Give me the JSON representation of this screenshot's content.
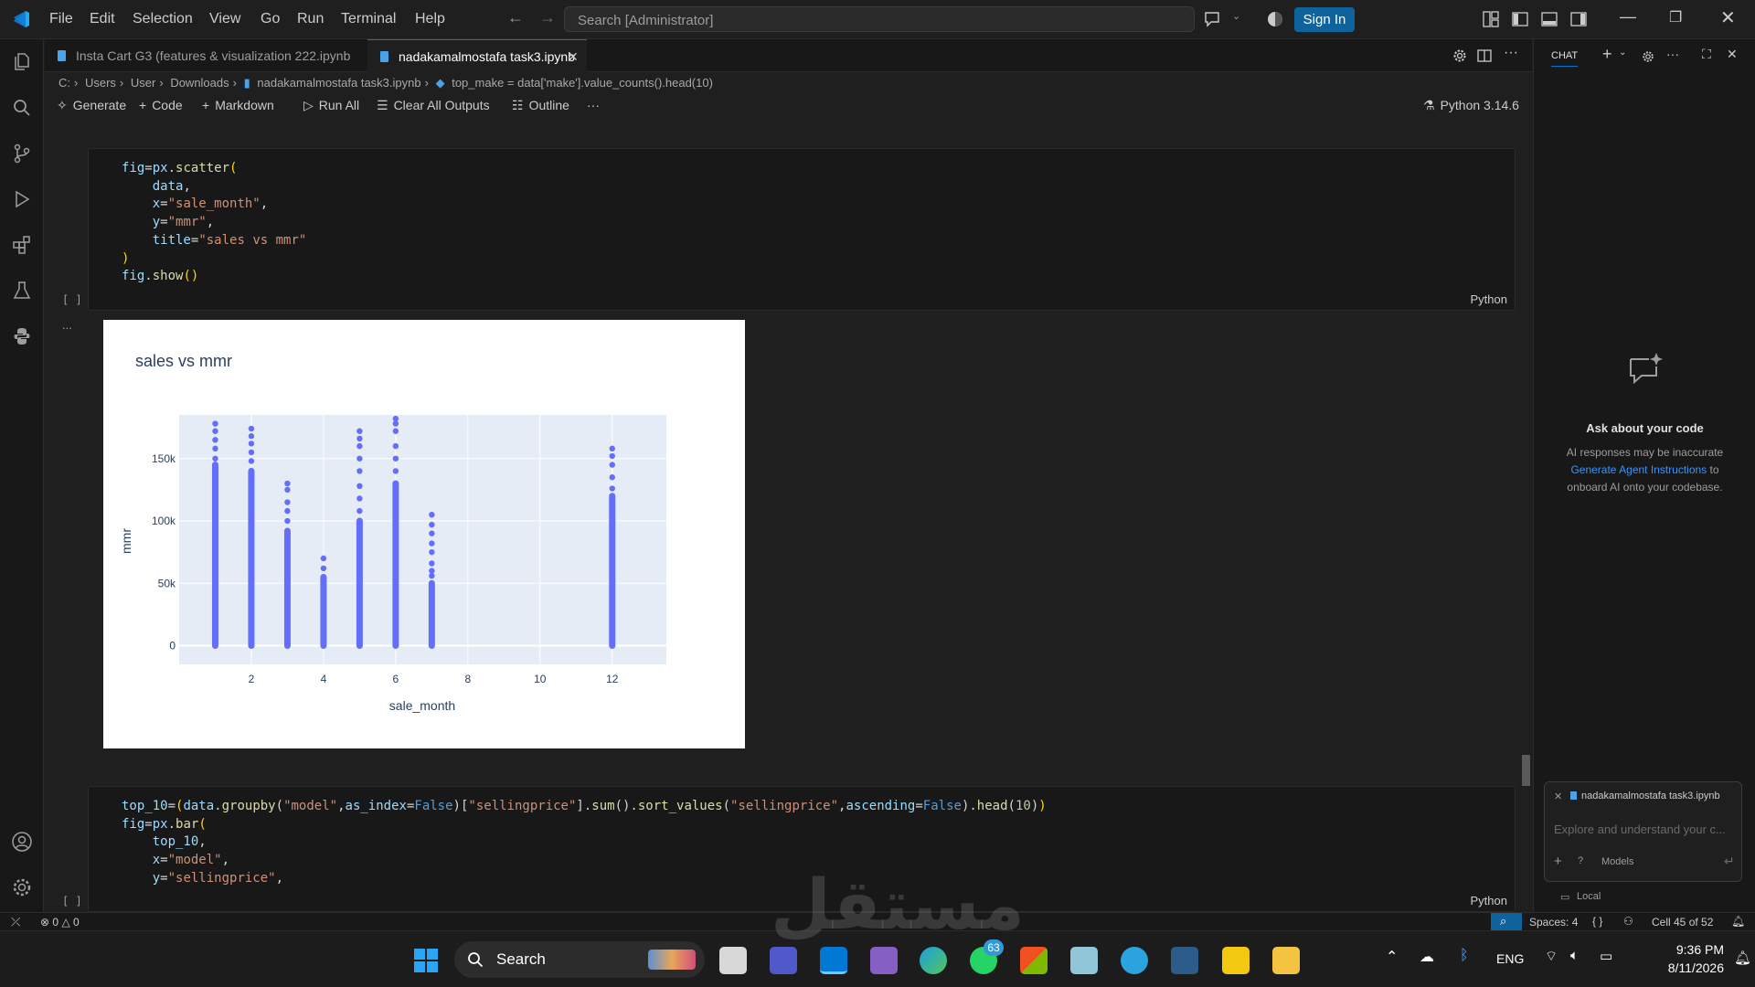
{
  "titlebar": {
    "menu": [
      "File",
      "Edit",
      "Selection",
      "View",
      "Go",
      "Run",
      "Terminal",
      "Help"
    ],
    "search_placeholder": "Search [Administrator]",
    "signin_label": "Sign In"
  },
  "tabs": [
    {
      "label": "Insta Cart G3 (features & visualization 222.ipynb",
      "active": false
    },
    {
      "label": "nadakamalmostafa task3.ipynb",
      "active": true
    }
  ],
  "breadcrumb": [
    "C:",
    "Users",
    "User",
    "Downloads",
    "nadakamalmostafa task3.ipynb",
    "top_make = data['make'].value_counts().head(10)"
  ],
  "toolbar": {
    "generate": "Generate",
    "code": "Code",
    "markdown": "Markdown",
    "run_all": "Run All",
    "clear_outputs": "Clear All Outputs",
    "outline": "Outline",
    "kernel": "Python 3.14.6"
  },
  "cells": [
    {
      "exec_count": "[ ]",
      "language": "Python"
    },
    {
      "exec_count": "[ ]",
      "language": "Python"
    }
  ],
  "output_ellipsis": "...",
  "chart_data": {
    "type": "scatter",
    "title": "sales vs mmr",
    "xlabel": "sale_month",
    "ylabel": "mmr",
    "xlim": [
      0,
      13.5
    ],
    "ylim": [
      -15000,
      185000
    ],
    "xticks": [
      2,
      4,
      6,
      8,
      10,
      12
    ],
    "yticks": [
      0,
      50000,
      100000,
      150000
    ],
    "ytick_labels": [
      "0",
      "50k",
      "100k",
      "150k"
    ],
    "color": "#636efa",
    "columns": [
      {
        "x": 1,
        "solid_max": 145000,
        "outliers": [
          150000,
          158000,
          165000,
          172000,
          178000
        ]
      },
      {
        "x": 2,
        "solid_max": 140000,
        "outliers": [
          148000,
          155000,
          162000,
          168000,
          174000
        ]
      },
      {
        "x": 3,
        "solid_max": 92000,
        "outliers": [
          100000,
          108000,
          115000,
          125000,
          130000
        ]
      },
      {
        "x": 4,
        "solid_max": 55000,
        "outliers": [
          62000,
          70000
        ]
      },
      {
        "x": 5,
        "solid_max": 100000,
        "outliers": [
          108000,
          118000,
          128000,
          140000,
          150000,
          160000,
          166000,
          172000
        ]
      },
      {
        "x": 6,
        "solid_max": 130000,
        "outliers": [
          140000,
          150000,
          160000,
          172000,
          178000,
          182000
        ]
      },
      {
        "x": 7,
        "solid_max": 50000,
        "outliers": [
          56000,
          60000,
          66000,
          75000,
          82000,
          90000,
          97000,
          105000
        ]
      },
      {
        "x": 12,
        "solid_max": 120000,
        "outliers": [
          126000,
          135000,
          145000,
          152000,
          158000
        ]
      }
    ]
  },
  "chat": {
    "header": "CHAT",
    "heading": "Ask about your code",
    "line1": "AI responses may be inaccurate",
    "link": "Generate Agent Instructions",
    "line2_suffix": " to",
    "line3": "onboard AI onto your codebase.",
    "context_file": "nadakamalmostafa task3.ipynb",
    "input_placeholder": "Explore and understand your c...",
    "models": "Models",
    "local": "Local"
  },
  "statusbar": {
    "errors": "0",
    "warnings": "0",
    "spaces": "Spaces: 4",
    "cell_info": "Cell 45 of 52"
  },
  "taskbar": {
    "search": "Search",
    "whatsapp_badge": "63",
    "lang": "ENG",
    "time": "9:36 PM",
    "date": "8/11/2026"
  },
  "watermark": "مستقل"
}
